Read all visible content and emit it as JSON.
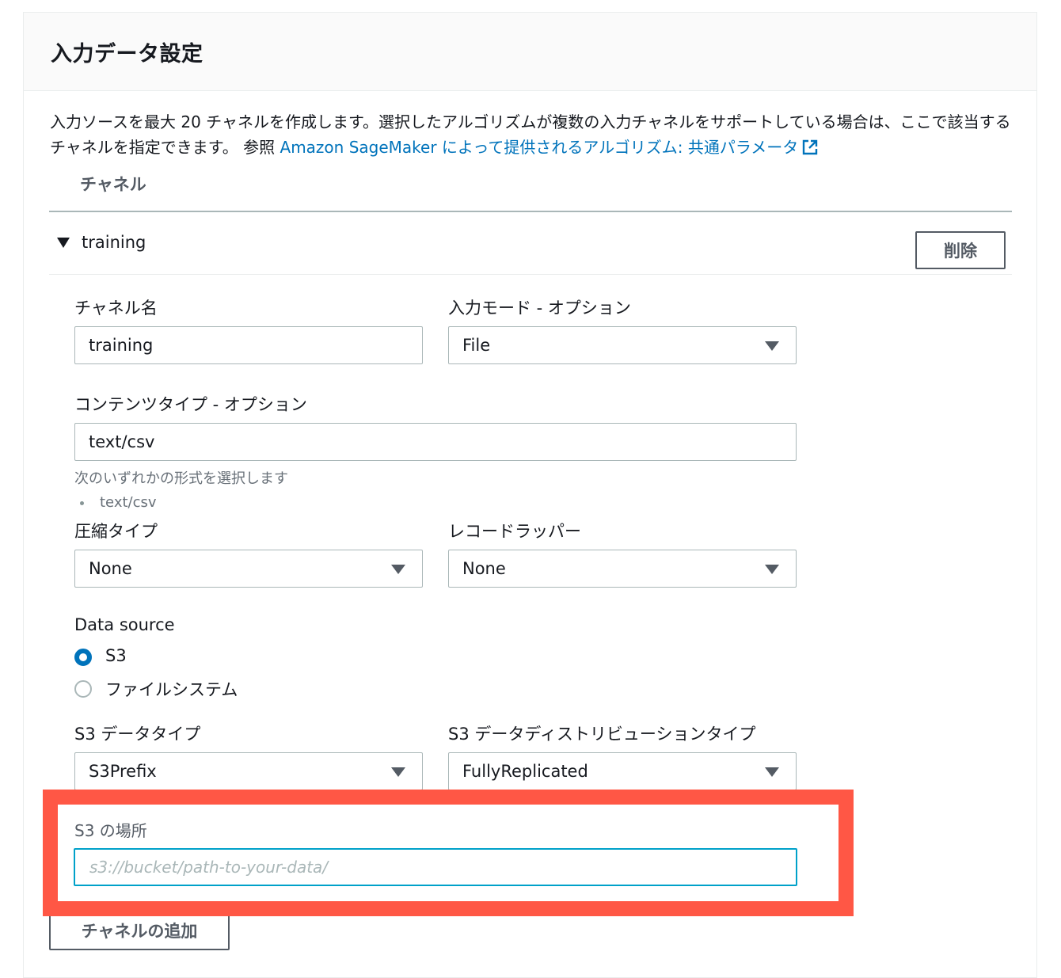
{
  "panel": {
    "title": "入力データ設定",
    "description": "入力ソースを最大 20 チャネルを作成します。選択したアルゴリズムが複数の入力チャネルをサポートしている場合は、ここで該当するチャネルを指定できます。 参照 ",
    "link_text": "Amazon SageMaker によって提供されるアルゴリズム: 共通パラメータ",
    "link_icon": "external-link-icon"
  },
  "channels": {
    "header": "チャネル",
    "channel": {
      "name": "training",
      "delete_label": "削除",
      "fields": {
        "channel_name": {
          "label": "チャネル名",
          "value": "training"
        },
        "input_mode": {
          "label": "入力モード - オプション",
          "value": "File"
        },
        "content_type": {
          "label": "コンテンツタイプ - オプション",
          "value": "text/csv",
          "hint": "次のいずれかの形式を選択します",
          "options": [
            "text/csv"
          ]
        },
        "compression_type": {
          "label": "圧縮タイプ",
          "value": "None"
        },
        "record_wrapper": {
          "label": "レコードラッパー",
          "value": "None"
        },
        "data_source": {
          "label": "Data source",
          "options": [
            "S3",
            "ファイルシステム"
          ],
          "selected": "S3"
        },
        "s3_data_type": {
          "label": "S3 データタイプ",
          "value": "S3Prefix"
        },
        "s3_distribution_type": {
          "label": "S3 データディストリビューションタイプ",
          "value": "FullyReplicated"
        },
        "s3_location": {
          "label": "S3 の場所",
          "placeholder": "s3://bucket/path-to-your-data/"
        }
      }
    },
    "add_label": "チャネルの追加"
  },
  "colors": {
    "link": "#0073bb",
    "highlight_border": "#ff5745",
    "focus_border": "#00a1c9"
  }
}
